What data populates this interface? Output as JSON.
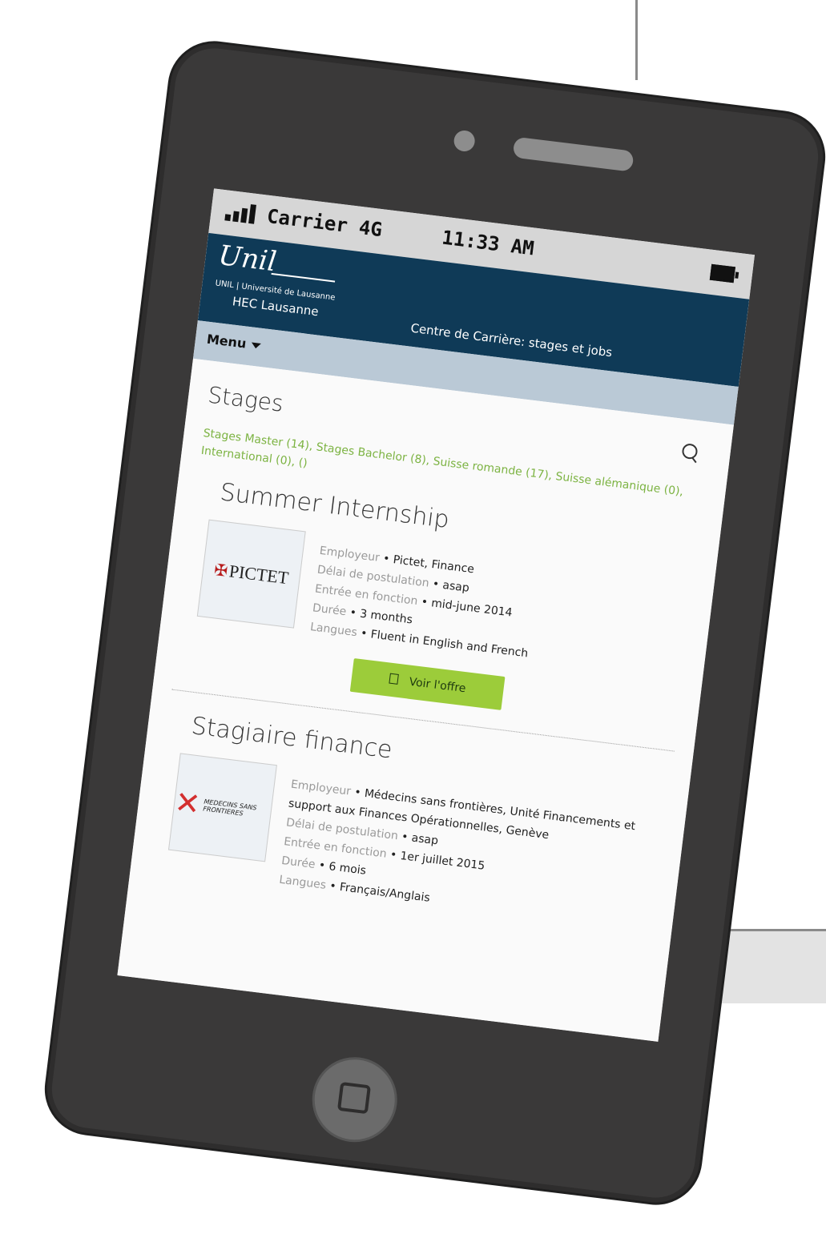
{
  "status_bar": {
    "carrier": "Carrier 4G",
    "time": "11:33 AM"
  },
  "header": {
    "logo_script": "Unil",
    "logo_sub": "UNIL | Université de Lausanne",
    "logo_hec": "HEC Lausanne",
    "site_title": "Centre de Carrière: stages et jobs"
  },
  "menu": {
    "label": "Menu"
  },
  "page": {
    "title": "Stages"
  },
  "categories": [
    "Stages Master (14)",
    "Stages Bachelor (8)",
    "Suisse romande (17)",
    "Suisse alémanique (0)",
    "International (0)",
    "()"
  ],
  "listings": [
    {
      "title": "Summer Internship",
      "logo_text": "PICTET",
      "details": [
        {
          "label": "Employeur",
          "value": "Pictet, Finance"
        },
        {
          "label": "Délai de postulation",
          "value": "asap"
        },
        {
          "label": "Entrée en fonction",
          "value": "mid-june 2014"
        },
        {
          "label": "Durée",
          "value": "3 months"
        },
        {
          "label": "Langues",
          "value": "Fluent in English and French"
        }
      ],
      "button": "Voir l'offre"
    },
    {
      "title": "Stagiaire finance",
      "logo_text": "MEDECINS SANS FRONTIERES",
      "details": [
        {
          "label": "Employeur",
          "value": "Médecins sans frontières, Unité Financements et support aux Finances Opérationnelles, Genève"
        },
        {
          "label": "Délai de postulation",
          "value": "asap"
        },
        {
          "label": "Entrée en fonction",
          "value": "1er juillet 2015"
        },
        {
          "label": "Durée",
          "value": "6 mois"
        },
        {
          "label": "Langues",
          "value": "Français/Anglais"
        }
      ]
    }
  ],
  "colors": {
    "header": "#0f3a57",
    "menubar": "#bac9d6",
    "accent_green": "#9ccc3a",
    "link_green": "#7cb342",
    "phone_body": "#3a3939"
  }
}
